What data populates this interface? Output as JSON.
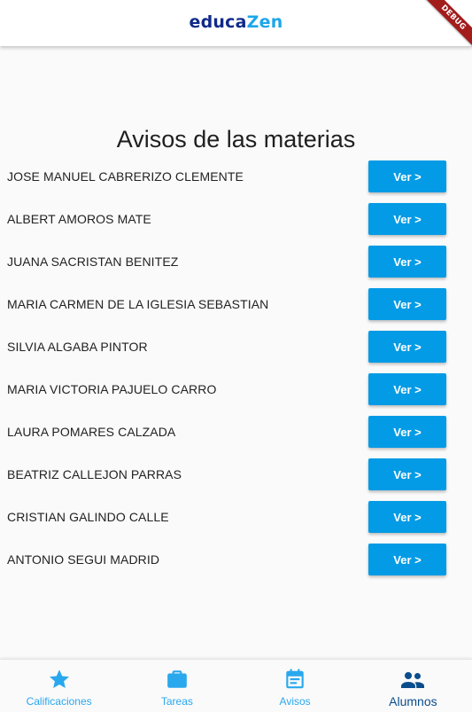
{
  "header": {
    "logo_part1": "educa",
    "logo_part2": "Zen",
    "debug_banner": "DEBUG"
  },
  "page": {
    "title": "Avisos de las materias"
  },
  "teachers": [
    {
      "name": "JOSE MANUEL CABRERIZO CLEMENTE",
      "button": "Ver >"
    },
    {
      "name": "ALBERT AMOROS MATE",
      "button": "Ver >"
    },
    {
      "name": "JUANA SACRISTAN BENITEZ",
      "button": "Ver >"
    },
    {
      "name": "MARIA CARMEN DE LA IGLESIA SEBASTIAN",
      "button": "Ver >"
    },
    {
      "name": "SILVIA ALGABA PINTOR",
      "button": "Ver >"
    },
    {
      "name": "MARIA VICTORIA PAJUELO CARRO",
      "button": "Ver >"
    },
    {
      "name": "LAURA POMARES CALZADA",
      "button": "Ver >"
    },
    {
      "name": "BEATRIZ CALLEJON PARRAS",
      "button": "Ver >"
    },
    {
      "name": "CRISTIAN GALINDO CALLE",
      "button": "Ver >"
    },
    {
      "name": "ANTONIO SEGUI MADRID",
      "button": "Ver >"
    }
  ],
  "bottom_nav": {
    "active_index": 3,
    "items": [
      {
        "label": "Calificaciones",
        "icon": "star-icon"
      },
      {
        "label": "Tareas",
        "icon": "briefcase-icon"
      },
      {
        "label": "Avisos",
        "icon": "calendar-icon"
      },
      {
        "label": "Alumnos",
        "icon": "people-icon"
      }
    ]
  },
  "colors": {
    "accent": "#039be5",
    "nav_inactive": "#29a8ee",
    "nav_active": "#0b4d8c",
    "logo_dark": "#0f2a8a",
    "logo_light": "#1ba6ea",
    "debug_banner": "#a21c1c"
  }
}
